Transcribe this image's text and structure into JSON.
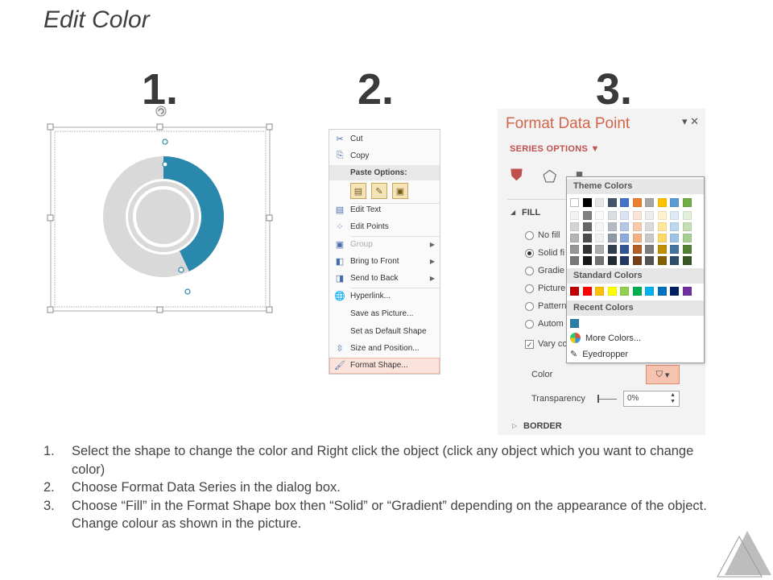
{
  "title": "Edit Color",
  "steps": [
    "1.",
    "2.",
    "3."
  ],
  "context_menu": {
    "items": [
      {
        "label": "Cut",
        "icon": "scissors-icon",
        "glyph": "✂"
      },
      {
        "label": "Copy",
        "icon": "copy-icon",
        "glyph": "⎘"
      },
      {
        "label": "Edit Text",
        "icon": "edit-text-icon",
        "glyph": "▤"
      },
      {
        "label": "Edit Points",
        "icon": "edit-points-icon",
        "glyph": "⁘"
      },
      {
        "label": "Group",
        "icon": "group-icon",
        "glyph": "▣"
      },
      {
        "label": "Bring to Front",
        "icon": "bring-front-icon",
        "glyph": "◧"
      },
      {
        "label": "Send to Back",
        "icon": "send-back-icon",
        "glyph": "◨"
      },
      {
        "label": "Hyperlink...",
        "icon": "hyperlink-icon",
        "glyph": "🌐"
      },
      {
        "label": "Save as Picture...",
        "icon": "",
        "glyph": ""
      },
      {
        "label": "Set as Default Shape",
        "icon": "",
        "glyph": ""
      },
      {
        "label": "Size and Position...",
        "icon": "size-position-icon",
        "glyph": "⇳"
      },
      {
        "label": "Format Shape...",
        "icon": "format-shape-icon",
        "glyph": "🖌"
      }
    ],
    "paste_options_label": "Paste Options:"
  },
  "format_pane": {
    "title": "Format Data Point",
    "series_options": "SERIES OPTIONS",
    "fill_label": "FILL",
    "fill_options": [
      "No fill",
      "Solid fi",
      "Gradie",
      "Picture",
      "Pattern",
      "Autom"
    ],
    "vary_colors": "Vary co",
    "color_label": "Color",
    "transparency_label": "Transparency",
    "transparency_value": "0%",
    "border_label": "BORDER"
  },
  "color_popup": {
    "theme_colors_label": "Theme Colors",
    "standard_colors_label": "Standard Colors",
    "recent_colors_label": "Recent Colors",
    "more_colors": "More Colors...",
    "eyedropper": "Eyedropper",
    "theme_top": [
      "#ffffff",
      "#000000",
      "#e7e6e6",
      "#44546a",
      "#4472c4",
      "#ed7d31",
      "#a5a5a5",
      "#ffc000",
      "#5b9bd5",
      "#70ad47"
    ],
    "standard": [
      "#c00000",
      "#ff0000",
      "#ffc000",
      "#ffff00",
      "#92d050",
      "#00b050",
      "#00b0f0",
      "#0070c0",
      "#002060",
      "#7030a0"
    ],
    "recent": [
      "#2a7fa8"
    ]
  },
  "donut": {
    "accent": "#2a88ac",
    "base": "#d9d9d9",
    "arc_fraction": 0.5
  },
  "instructions": [
    {
      "num": "1.",
      "text": "Select the shape to change the color and Right click the object (click any object which you want to change color)"
    },
    {
      "num": "2.",
      "text": "Choose Format Data Series in the dialog box."
    },
    {
      "num": "3.",
      "text": "Choose “Fill” in the Format Shape box then “Solid” or “Gradient” depending on the appearance of the object. Change colour as shown in the picture."
    }
  ]
}
